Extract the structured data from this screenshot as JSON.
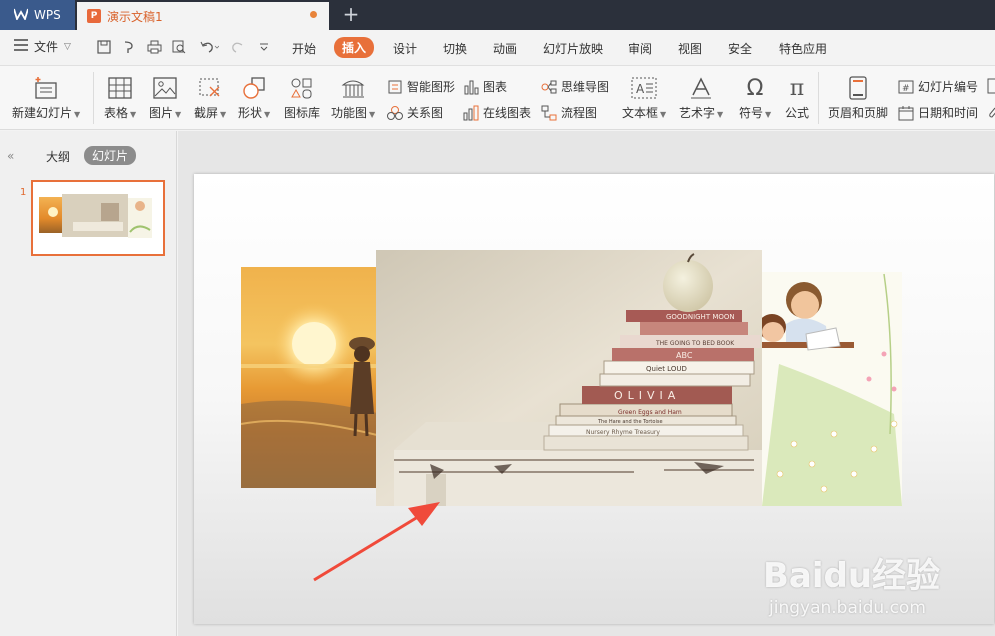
{
  "titlebar": {
    "app_tab": "WPS",
    "doc_tab": "演示文稿1",
    "doc_icon": "P",
    "new_tab": "+"
  },
  "menu": {
    "file": "文件",
    "items": [
      "开始",
      "插入",
      "设计",
      "切换",
      "动画",
      "幻灯片放映",
      "审阅",
      "视图",
      "安全",
      "特色应用"
    ],
    "active": "插入"
  },
  "ribbon": {
    "new_slide": "新建幻灯片",
    "table": "表格",
    "picture": "图片",
    "screenshot": "截屏",
    "shape": "形状",
    "icon_lib": "图标库",
    "function_chart": "功能图",
    "smart_shape": "智能图形",
    "chart": "图表",
    "relation": "关系图",
    "online_chart": "在线图表",
    "mindmap": "思维导图",
    "flowchart": "流程图",
    "textbox": "文本框",
    "wordart": "艺术字",
    "symbol": "符号",
    "formula": "公式",
    "header_footer": "页眉和页脚",
    "slide_number": "幻灯片编号",
    "datetime": "日期和时间"
  },
  "leftpane": {
    "outline_tab": "大纲",
    "slides_tab": "幻灯片",
    "slide_number": "1"
  },
  "slide_images": {
    "books_spines": [
      "GOODNIGHT MOON",
      "THE GOING TO BED BOOK",
      "ABC",
      "Quiet LOUD",
      "OLIVIA",
      "Green Eggs and Ham",
      "The Hare and the Tortoise",
      "Nursery Rhyme Treasury"
    ]
  },
  "watermark": {
    "brand": "Baidu经验",
    "url": "jingyan.baidu.com"
  },
  "colors": {
    "accent": "#e8703a",
    "titlebar": "#2b303b",
    "wps_tab": "#3a5a8c",
    "arrow": "#f04a3a"
  }
}
